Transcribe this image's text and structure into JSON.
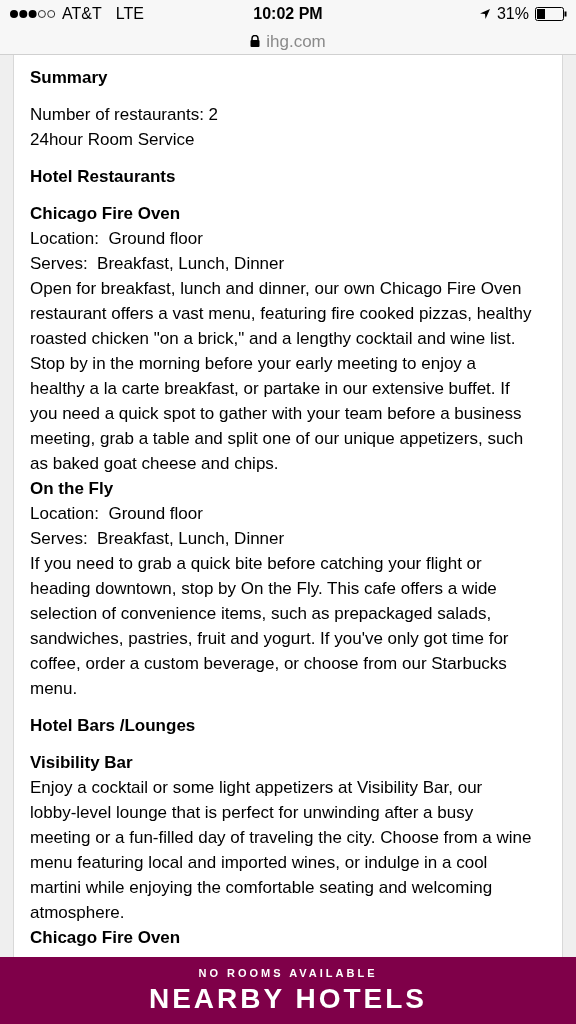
{
  "status_bar": {
    "carrier": "AT&T",
    "network": "LTE",
    "time": "10:02 PM",
    "battery": "31%"
  },
  "address_bar": {
    "url": "ihg.com"
  },
  "sections": [
    {
      "heading": "Summary",
      "lines": [
        "Number of restaurants: 2",
        "24hour Room Service"
      ]
    },
    {
      "heading": "Hotel Restaurants",
      "venues": [
        {
          "name": "Chicago Fire Oven",
          "details": [
            "Location:  Ground floor",
            "Serves:  Breakfast, Lunch, Dinner"
          ],
          "description": "Open for breakfast, lunch and dinner, our own Chicago Fire Oven restaurant offers a vast menu, featuring fire cooked pizzas, healthy roasted chicken \"on a brick,\" and a lengthy cocktail and wine list. Stop by in the morning before your early meeting to enjoy a healthy a la carte breakfast, or partake in our extensive buffet. If you need a quick spot to gather with your team before a business meeting, grab a table and split one of our unique appetizers, such as baked goat cheese and chips."
        },
        {
          "name": "On the Fly",
          "details": [
            "Location:  Ground floor",
            "Serves:  Breakfast, Lunch, Dinner"
          ],
          "description": "If you need to grab a quick bite before catching your flight or heading downtown, stop by On the Fly. This cafe offers a wide selection of convenience items, such as prepackaged salads, sandwiches, pastries, fruit and yogurt. If you've only got time for coffee, order a custom beverage, or choose from our Starbucks menu."
        }
      ]
    },
    {
      "heading": "Hotel Bars /Lounges",
      "venues": [
        {
          "name": "Visibility Bar",
          "description": "Enjoy a cocktail or some light appetizers at Visibility Bar, our lobby-level lounge that is perfect for unwinding after a busy meeting or a fun-filled day of traveling the city. Choose from a wine menu featuring local and imported wines, or indulge in a cool martini while enjoying the comfortable seating and welcoming atmosphere."
        },
        {
          "name": "Chicago Fire Oven"
        }
      ]
    }
  ],
  "bottom_bar": {
    "note": "NO ROOMS AVAILABLE",
    "button": "NEARBY HOTELS"
  }
}
